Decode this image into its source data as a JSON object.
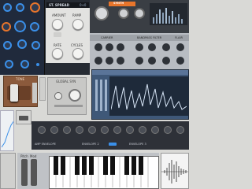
{
  "stereo_spread": {
    "title": "ST. SPREAD",
    "mode_value": "0+0",
    "amount_label": "AMOUNT",
    "ramp_label": "RAMP",
    "rate_label": "RATE",
    "cycles_label": "CYCLES"
  },
  "synth": {
    "title_badge": "SYNTH",
    "carrier_label": "CARRIER",
    "filter_label": "BANDPASS FILTER",
    "filter_aux_label": "FLAIR"
  },
  "tone": {
    "title": "TONE"
  },
  "global": {
    "title": "GLOBAL SYN"
  },
  "envelopes": {
    "amp_label": "AMP ENVELOPE",
    "env2_label": "ENVELOPE 2",
    "env3_label": "ENVELOPE 3"
  },
  "keyboard": {
    "pitch_label": "Pitch",
    "mod_label": "Mod"
  },
  "colors": {
    "accent_orange": "#e8752b",
    "accent_blue": "#3a8fe8",
    "screen_dark": "#1e2a3a"
  }
}
